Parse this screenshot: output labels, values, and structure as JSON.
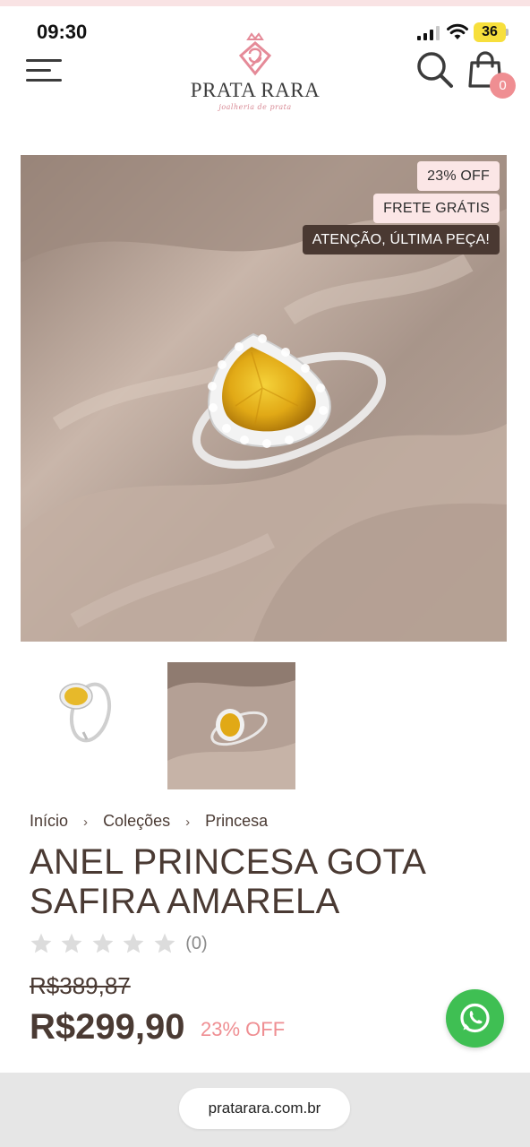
{
  "status_bar": {
    "time": "09:30",
    "battery": "36"
  },
  "header": {
    "logo_name": "PRATA RARA",
    "logo_tagline": "joalheria de prata",
    "cart_count": "0",
    "icons": {
      "menu": "hamburger-menu-icon",
      "search": "search-icon",
      "cart": "shopping-bag-icon"
    }
  },
  "gallery": {
    "badges": [
      "23% OFF",
      "FRETE GRÁTIS",
      "ATENÇÃO, ÚLTIMA PEÇA!"
    ],
    "thumbnails": [
      "ring-white-background",
      "ring-on-fabric"
    ]
  },
  "breadcrumb": {
    "items": [
      "Início",
      "Coleções",
      "Princesa"
    ]
  },
  "product": {
    "title": "ANEL PRINCESA GOTA SAFIRA AMARELA",
    "rating_stars": 0,
    "rating_max": 5,
    "rating_count": "(0)",
    "old_price": "R$389,87",
    "price": "R$299,90",
    "discount": "23% OFF"
  },
  "browser": {
    "url": "pratarara.com.br"
  },
  "colors": {
    "accent_pink": "#ef8e92",
    "badge_light": "#fbe6e6",
    "badge_dark": "#4a3932",
    "text_brown": "#4a3a33",
    "whatsapp_green": "#3fbf53"
  }
}
